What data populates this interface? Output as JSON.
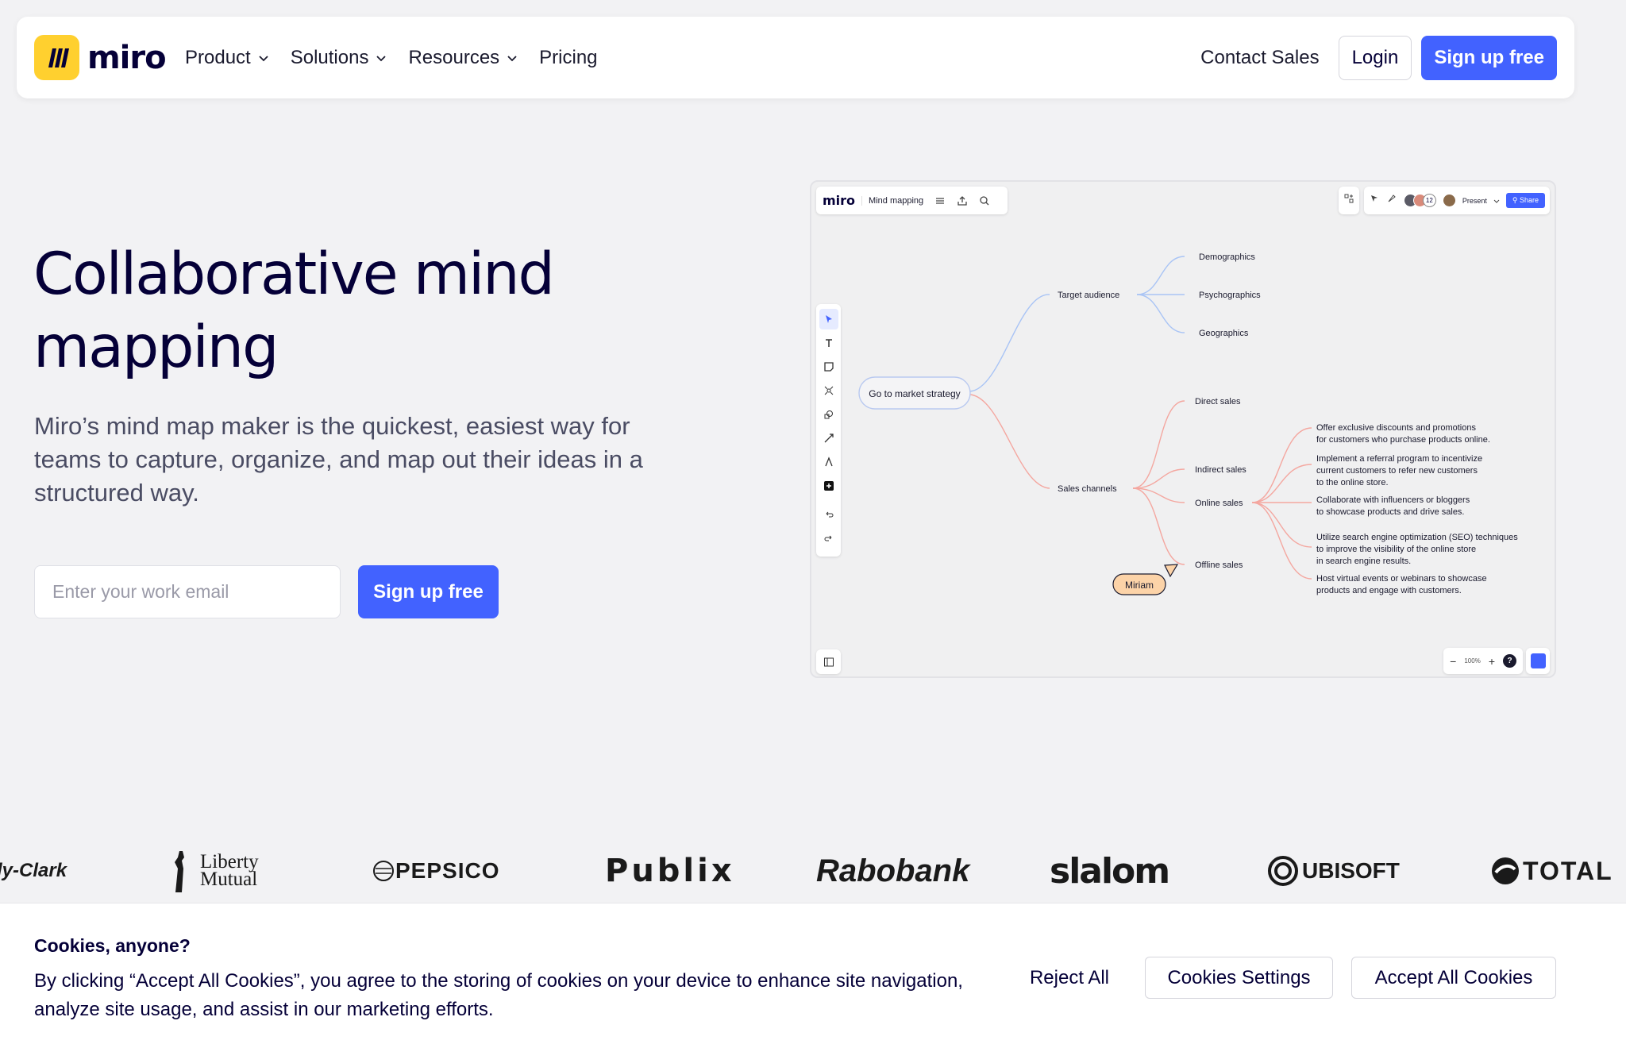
{
  "nav": {
    "brand": "miro",
    "links": [
      {
        "label": "Product",
        "dropdown": true
      },
      {
        "label": "Solutions",
        "dropdown": true
      },
      {
        "label": "Resources",
        "dropdown": true
      },
      {
        "label": "Pricing",
        "dropdown": false
      }
    ],
    "contact_sales": "Contact Sales",
    "login": "Login",
    "signup": "Sign up free"
  },
  "hero": {
    "title": "Collaborative mind mapping",
    "description": "Miro’s mind map maker is the quickest, easiest way for teams to capture, organize, and map out their ideas in a structured way.",
    "email_placeholder": "Enter your work email",
    "email_value": "",
    "signup": "Sign up free"
  },
  "board": {
    "brand": "miro",
    "board_name": "Mind mapping",
    "present": "Present",
    "share": "Share",
    "collaborator_count": "12",
    "zoom": "100%",
    "help": "?",
    "colors": {
      "blue_branch": "#a9c4f5",
      "red_branch": "#f4a7a0",
      "cursor_tag": "#fcd3a8",
      "accent": "#4262ff"
    },
    "mindmap": {
      "root": "Go to market strategy",
      "branches": [
        {
          "label": "Target audience",
          "children": [
            "Demographics",
            "Psychographics",
            "Geographics"
          ]
        },
        {
          "label": "Sales channels",
          "children": [
            "Direct sales",
            "Indirect sales",
            "Online sales",
            "Offline sales"
          ]
        }
      ],
      "online_ideas": [
        [
          "Offer exclusive discounts and promotions",
          "for customers who purchase products online."
        ],
        [
          "Implement a referral program to incentivize",
          "current customers to refer new customers",
          "to the online store."
        ],
        [
          "Collaborate with influencers or bloggers",
          "to showcase products and drive sales."
        ],
        [
          "Utilize search engine optimization (SEO) techniques",
          "to improve the visibility of the online store",
          "in search engine results."
        ],
        [
          "Host virtual events or webinars to showcase",
          "products and engage with customers."
        ]
      ],
      "cursor_name": "Miriam"
    }
  },
  "logos": [
    "ly-Clark",
    "Liberty",
    "Mutual",
    "PEPSICO",
    "Publix",
    "Rabobank",
    "slalom",
    "UBISOFT",
    "TOTAL"
  ],
  "cookie": {
    "title": "Cookies, anyone?",
    "text": "By clicking “Accept All Cookies”, you agree to the storing of cookies on your device to enhance site navigation, analyze site usage, and assist in our marketing efforts.",
    "reject": "Reject All",
    "settings": "Cookies Settings",
    "accept": "Accept All Cookies"
  }
}
